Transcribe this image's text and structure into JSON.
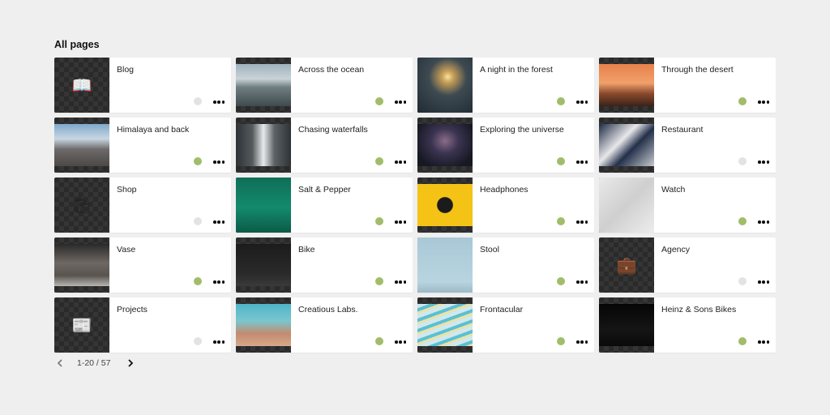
{
  "heading": "All pages",
  "colors": {
    "published": "#a1bd6a",
    "draft": "#e3e3e3"
  },
  "pages": [
    {
      "title": "Blog",
      "status": "draft",
      "thumb": "emoji",
      "icon": "book-icon",
      "glyph": "📖"
    },
    {
      "title": "Across the ocean",
      "status": "published",
      "thumb": "photo",
      "icon": "ocean-photo",
      "bg": "linear-gradient(180deg,#9fb2bd 0%,#c9d3d8 35%,#6f7e82 55%,#3f4a4e 100%)"
    },
    {
      "title": "A night in the forest",
      "status": "published",
      "thumb": "photo",
      "full": true,
      "icon": "tent-photo",
      "bg": "radial-gradient(circle at 55% 35%,#f7e2a0 0%,#c9a057 12%,#3e4a52 40%,#1f2a33 100%)"
    },
    {
      "title": "Through the desert",
      "status": "published",
      "thumb": "photo",
      "icon": "desert-photo",
      "bg": "linear-gradient(180deg,#e8814b 0%,#f0a06a 45%,#8a4a2e 70%,#3a2218 100%)"
    },
    {
      "title": "Himalaya and back",
      "status": "published",
      "thumb": "photo",
      "icon": "mountain-photo",
      "bg": "linear-gradient(180deg,#7fa8cc 0%,#c8d7e2 35%,#6d6a6a 60%,#4c4845 100%)"
    },
    {
      "title": "Chasing waterfalls",
      "status": "published",
      "thumb": "photo",
      "icon": "waterfall-photo",
      "bg": "linear-gradient(90deg,#2c3235 0%,#555b5d 30%,#e6eaec 50%,#5c6264 70%,#2d3336 100%)"
    },
    {
      "title": "Exploring the universe",
      "status": "published",
      "thumb": "photo",
      "icon": "galaxy-photo",
      "bg": "radial-gradient(ellipse at 50% 40%,#8a6c8a 0%,#3b3451 35%,#161822 80%)"
    },
    {
      "title": "Restaurant",
      "status": "draft",
      "thumb": "photo",
      "icon": "restaurant-photo",
      "bg": "linear-gradient(135deg,#1e2a44 0%,#e8e8ea 40%,#23304a 60%,#c7c9cf 100%)"
    },
    {
      "title": "Shop",
      "status": "draft",
      "thumb": "emoji",
      "icon": "shopping-bags-icon",
      "glyph": "🛍"
    },
    {
      "title": "Salt & Pepper",
      "status": "published",
      "thumb": "photo",
      "full": true,
      "icon": "bottle-photo",
      "bg": "linear-gradient(180deg,#0f6e58 0%,#138a6c 55%,#0b5a47 100%)"
    },
    {
      "title": "Headphones",
      "status": "published",
      "thumb": "photo",
      "icon": "headphones-photo",
      "bg": "radial-gradient(circle at 50% 50%,#1b1b1b 0%,#1b1b1b 22%,#f4c315 24%,#f4c315 100%)"
    },
    {
      "title": "Watch",
      "status": "published",
      "thumb": "photo",
      "full": true,
      "icon": "watch-photo",
      "bg": "linear-gradient(135deg,#e9e9e9 0%,#cfcfcf 50%,#ededed 100%)"
    },
    {
      "title": "Vase",
      "status": "published",
      "thumb": "photo",
      "icon": "vase-photo",
      "bg": "linear-gradient(180deg,#2a2a2a 0%,#6e6863 45%,#5a5450 75%,#b8b6b2 100%)"
    },
    {
      "title": "Bike",
      "status": "published",
      "thumb": "photo",
      "icon": "bike-photo",
      "bg": "linear-gradient(180deg,#1c1c1c 0%,#2a2a2a 70%,#3a3a3a 100%)"
    },
    {
      "title": "Stool",
      "status": "published",
      "thumb": "photo",
      "full": true,
      "icon": "stool-photo",
      "bg": "linear-gradient(180deg,#a9c8d6 0%,#b8d4e0 80%,#9cb9c6 100%)"
    },
    {
      "title": "Agency",
      "status": "draft",
      "thumb": "emoji",
      "icon": "briefcase-icon",
      "glyph": "💼"
    },
    {
      "title": "Projects",
      "status": "draft",
      "thumb": "emoji",
      "icon": "document-icon",
      "glyph": "📰"
    },
    {
      "title": "Creatious Labs.",
      "status": "published",
      "thumb": "photo",
      "icon": "lagoon-photo",
      "bg": "linear-gradient(180deg,#4fb4c8 0%,#78c7d0 40%,#c28b6f 70%,#d6a889 100%)"
    },
    {
      "title": "Frontacular",
      "status": "published",
      "thumb": "photo",
      "icon": "pattern-photo",
      "bg": "repeating-linear-gradient(160deg,#cfe7ee 0px,#cfe7ee 5px,#5bc0d2 5px,#5bc0d2 9px,#e8e2a8 9px,#e8e2a8 12px)"
    },
    {
      "title": "Heinz & Sons Bikes",
      "status": "published",
      "thumb": "photo",
      "icon": "bike-dark-photo",
      "bg": "linear-gradient(180deg,#050505 0%,#151515 60%,#0a0a0a 100%)"
    }
  ],
  "pagination": {
    "range": "1-20 / 57",
    "prev_icon": "chevron-left-icon",
    "next_icon": "chevron-right-icon"
  }
}
